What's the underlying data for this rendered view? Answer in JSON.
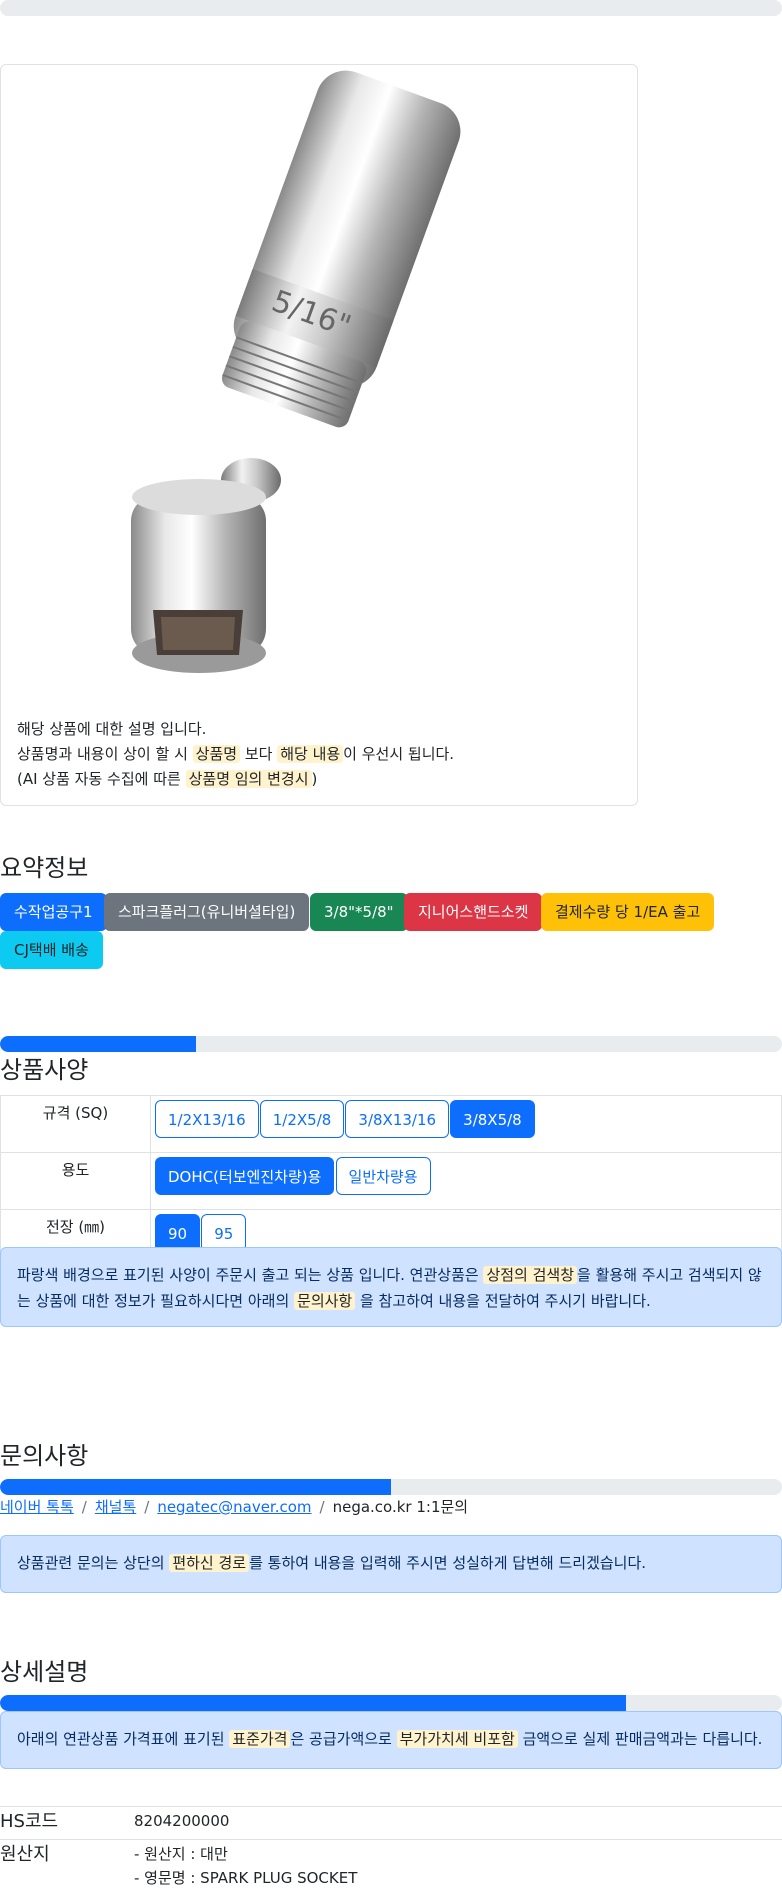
{
  "product": {
    "image_alt": "spark plug universal socket",
    "desc_line1": "해당 상품에 대한 설명 입니다.",
    "desc_line2_a": "상품명과 내용이 상이 할 시 ",
    "desc_line2_h1": "상품명",
    "desc_line2_b": " 보다 ",
    "desc_line2_h2": "해당 내용",
    "desc_line2_c": "이 우선시 됩니다.",
    "desc_line3_a": "(AI 상품 자동 수집에 따른 ",
    "desc_line3_h": "상품명 임의 변경시",
    "desc_line3_b": ")"
  },
  "summary": {
    "title": "요약정보",
    "badges": [
      {
        "label": "수작업공구1",
        "color": "#0d6efd"
      },
      {
        "label": "스파크플러그(유니버셜타입)",
        "color": "#6c757d"
      },
      {
        "label": "3/8\"*5/8\"",
        "color": "#198754"
      },
      {
        "label": "지니어스핸드소켓",
        "color": "#dc3545"
      },
      {
        "label": "결제수량 당 1/EA 출고",
        "color": "#ffc107"
      },
      {
        "label": "CJ택배 배송",
        "color": "#0dcaf0"
      }
    ]
  },
  "specs": {
    "progress": 25,
    "title": "상품사양",
    "rows": [
      {
        "label": "규격 (SQ)",
        "options": [
          "1/2X13/16",
          "1/2X5/8",
          "3/8X13/16",
          "3/8X5/8"
        ],
        "selected": "3/8X5/8"
      },
      {
        "label": "용도",
        "options": [
          "DOHC(터보엔진차량)용",
          "일반차량용"
        ],
        "selected": "DOHC(터보엔진차량)용"
      },
      {
        "label": "전장 (㎜)",
        "options": [
          "90",
          "95"
        ],
        "selected": "90"
      }
    ],
    "notice_a": "파랑색 배경으로 표기된 사양이 주문시 출고 되는 상품 입니다. 연관상품은 ",
    "notice_h1": "상점의 검색창",
    "notice_b": "을 활용해 주시고 검색되지 않는 상품에 대한 정보가 필요하시다면 아래의 ",
    "notice_h2": "문의사항",
    "notice_c": " 을 참고하여 내용을 전달하여 주시기 바랍니다."
  },
  "inquiry": {
    "title": "문의사항",
    "progress": 50,
    "links": [
      "네이버 톡톡",
      "채널톡",
      "negatec@naver.com"
    ],
    "plain": "nega.co.kr 1:1문의",
    "notice_a": "상품관련 문의는 상단의 ",
    "notice_h": "편하신 경로",
    "notice_b": "를 통하여 내용을 입력해 주시면 성실하게 답변해 드리겠습니다."
  },
  "detail": {
    "title": "상세설명",
    "progress": 80,
    "notice_a": "아래의 연관상품 가격표에 표기된 ",
    "notice_h1": "표준가격",
    "notice_b": "은 공급가액으로 ",
    "notice_h2": "부가가치세 비포함",
    "notice_c": " 금액으로 실제 판매금액과는 다릅니다.",
    "hs_label": "HS코드",
    "hs_value": "8204200000",
    "origin_label": "원산지",
    "origin_line1": "- 원산지 : 대만",
    "origin_line2": "- 영문명 : SPARK PLUG SOCKET"
  }
}
